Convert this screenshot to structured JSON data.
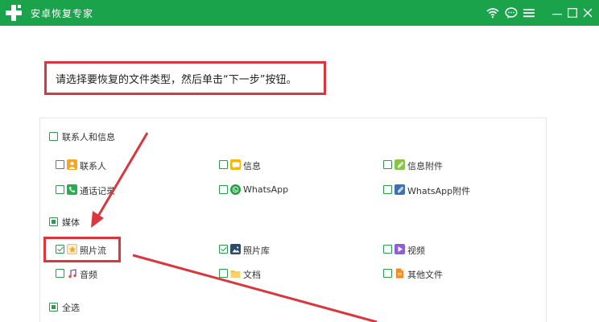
{
  "window": {
    "title": "安卓恢复专家"
  },
  "instruction": "请选择要恢复的文件类型，然后单击“下一步”按钮。",
  "sections": {
    "contacts": {
      "label": "联系人和信息",
      "items": [
        {
          "label": "联系人",
          "icon": "contact-icon",
          "checked": false
        },
        {
          "label": "信息",
          "icon": "message-icon",
          "checked": false
        },
        {
          "label": "信息附件",
          "icon": "attachment-icon",
          "checked": false
        },
        {
          "label": "通话记录",
          "icon": "phone-icon",
          "checked": false
        },
        {
          "label": "WhatsApp",
          "icon": "whatsapp-icon",
          "checked": false
        },
        {
          "label": "WhatsApp附件",
          "icon": "whatsapp-attachment-icon",
          "checked": false
        }
      ]
    },
    "media": {
      "label": "媒体",
      "state": "partial",
      "items": [
        {
          "label": "照片流",
          "icon": "photo-stream-icon",
          "checked": true
        },
        {
          "label": "照片库",
          "icon": "photo-library-icon",
          "checked": true
        },
        {
          "label": "视频",
          "icon": "video-icon",
          "checked": false
        },
        {
          "label": "音频",
          "icon": "audio-icon",
          "checked": false
        },
        {
          "label": "文档",
          "icon": "folder-icon",
          "checked": false
        },
        {
          "label": "其他文件",
          "icon": "file-icon",
          "checked": false
        }
      ]
    },
    "select_all": {
      "label": "全选",
      "state": "partial"
    }
  },
  "colors": {
    "titlebar": "#1aa34a",
    "accent": "#2e9b4f",
    "annotation_red": "#d9363e"
  }
}
